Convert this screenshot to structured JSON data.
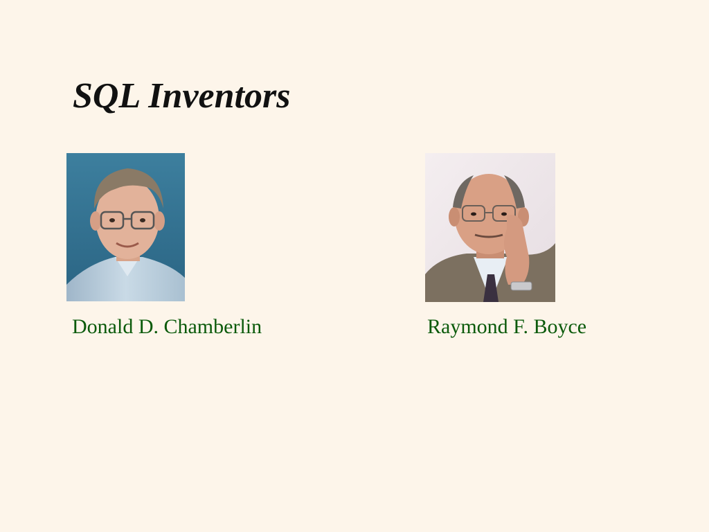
{
  "slide": {
    "title": "SQL Inventors"
  },
  "people": [
    {
      "name": "Donald D. Chamberlin",
      "photo": "portrait-photo"
    },
    {
      "name": "Raymond F. Boyce",
      "photo": "portrait-photo"
    }
  ],
  "colors": {
    "background": "#fdf5ea",
    "caption": "#0b5a0b",
    "title": "#111111"
  }
}
